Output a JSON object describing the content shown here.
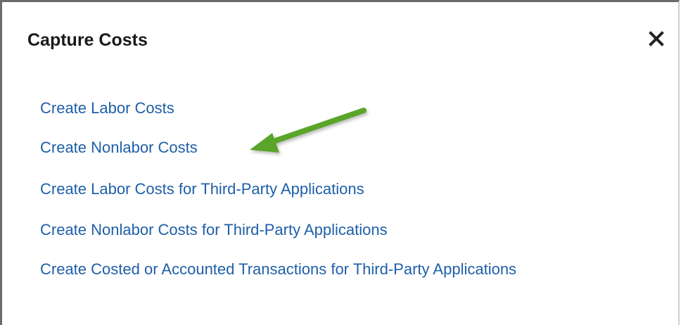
{
  "dialog": {
    "title": "Capture Costs",
    "close_icon": "close-icon",
    "close_glyph": "✕"
  },
  "links": [
    "Create Labor Costs",
    "Create Nonlabor Costs",
    "Create Labor Costs for Third-Party Applications",
    "Create Nonlabor Costs for Third-Party Applications",
    "Create Costed or Accounted Transactions for Third-Party Applications"
  ],
  "colors": {
    "link": "#1f5fa8",
    "title": "#1a1a1a",
    "arrow": "#5aa52c"
  },
  "annotation": {
    "icon": "green-arrow-icon",
    "points_to": "Create Nonlabor Costs"
  }
}
